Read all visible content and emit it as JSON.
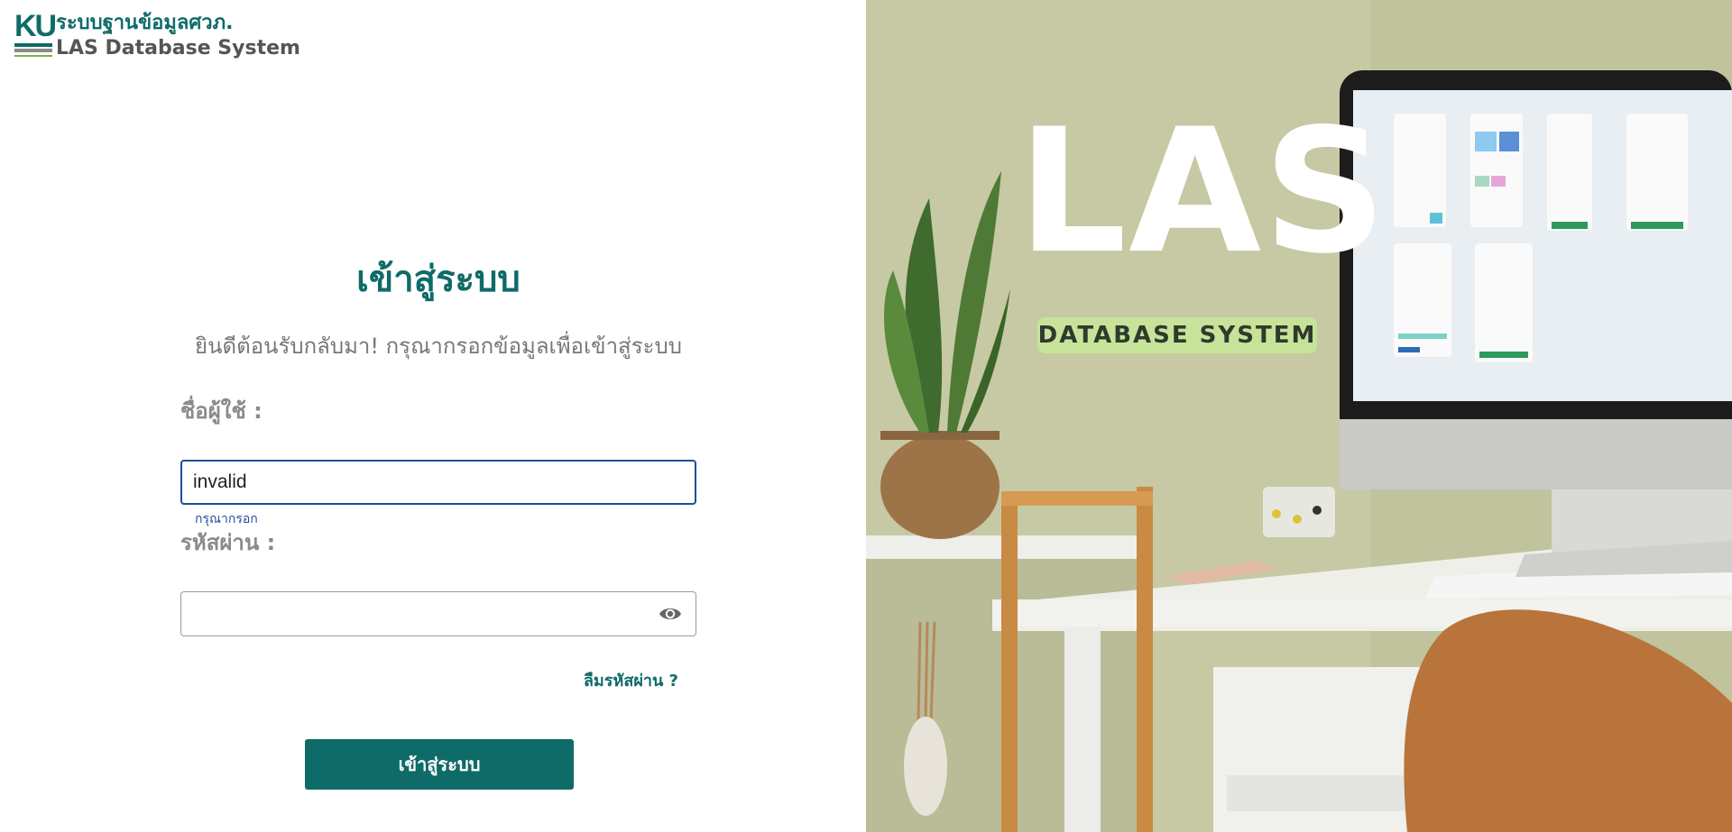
{
  "brand": {
    "logo_letters": "KU",
    "thai_name": "ระบบฐานข้อมูลศวภ.",
    "english_name": "LAS Database System"
  },
  "form": {
    "title": "เข้าสู่ระบบ",
    "subtitle": "ยินดีต้อนรับกลับมา! กรุณากรอกข้อมูลเพื่อเข้าสู่ระบบ",
    "username_label": "ชื่อผู้ใช้ :",
    "username_value": "invalid",
    "username_helper": "กรุณากรอก",
    "password_label": "รหัสผ่าน :",
    "password_value": "",
    "show_password_icon": "eye-icon",
    "forgot_link": "ลืมรหัสผ่าน ?",
    "submit_label": "เข้าสู่ระบบ"
  },
  "hero": {
    "title": "LAS",
    "subtitle": "DATABASE SYSTEM"
  },
  "colors": {
    "primary": "#0f6b68",
    "focus_border": "#1f4e9c",
    "label_gray": "#8a8a8a",
    "badge_green": "#c7e39a"
  }
}
